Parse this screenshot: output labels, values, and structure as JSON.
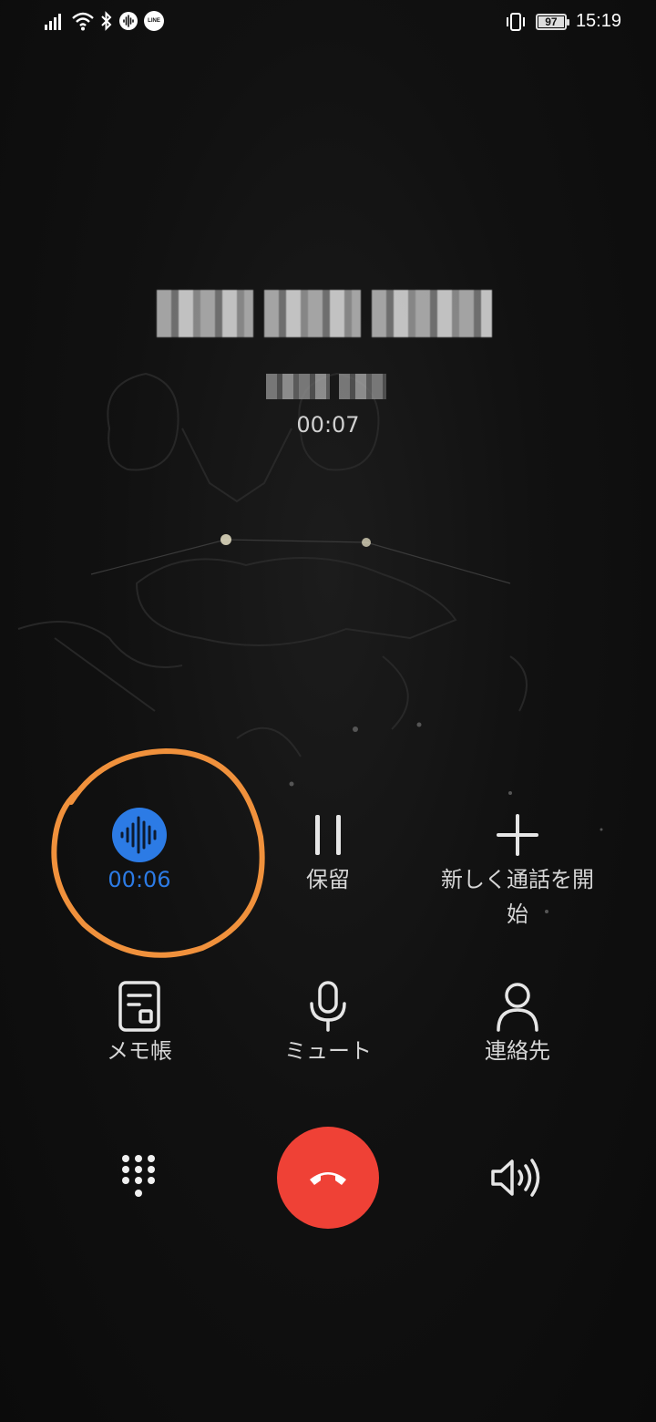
{
  "status_bar": {
    "time": "15:19",
    "battery_level": "97",
    "left_icons": [
      "signal-icon",
      "wifi-icon",
      "bluetooth-icon",
      "voice-record-notification-icon",
      "line-app-icon"
    ],
    "line_badge": "LINE",
    "right_icons": [
      "vibrate-icon",
      "battery-icon"
    ]
  },
  "call": {
    "caller_name": "",
    "caller_number": "",
    "elapsed": "00:07"
  },
  "controls": {
    "record": {
      "label": "00:06",
      "icon": "record-waveform-icon",
      "active_color": "#2c7be5"
    },
    "hold": {
      "label": "保留",
      "icon": "pause-icon"
    },
    "add_call": {
      "label": "新しく通話を開始",
      "icon": "plus-icon"
    },
    "notes": {
      "label": "メモ帳",
      "icon": "memo-icon"
    },
    "mute": {
      "label": "ミュート",
      "icon": "microphone-icon"
    },
    "contacts": {
      "label": "連絡先",
      "icon": "person-icon"
    }
  },
  "bottom_bar": {
    "keypad_icon": "dialpad-icon",
    "end_call_icon": "hang-up-icon",
    "end_call_color": "#ef4136",
    "speaker_icon": "speaker-icon"
  },
  "annotation_color": "#f0913c"
}
